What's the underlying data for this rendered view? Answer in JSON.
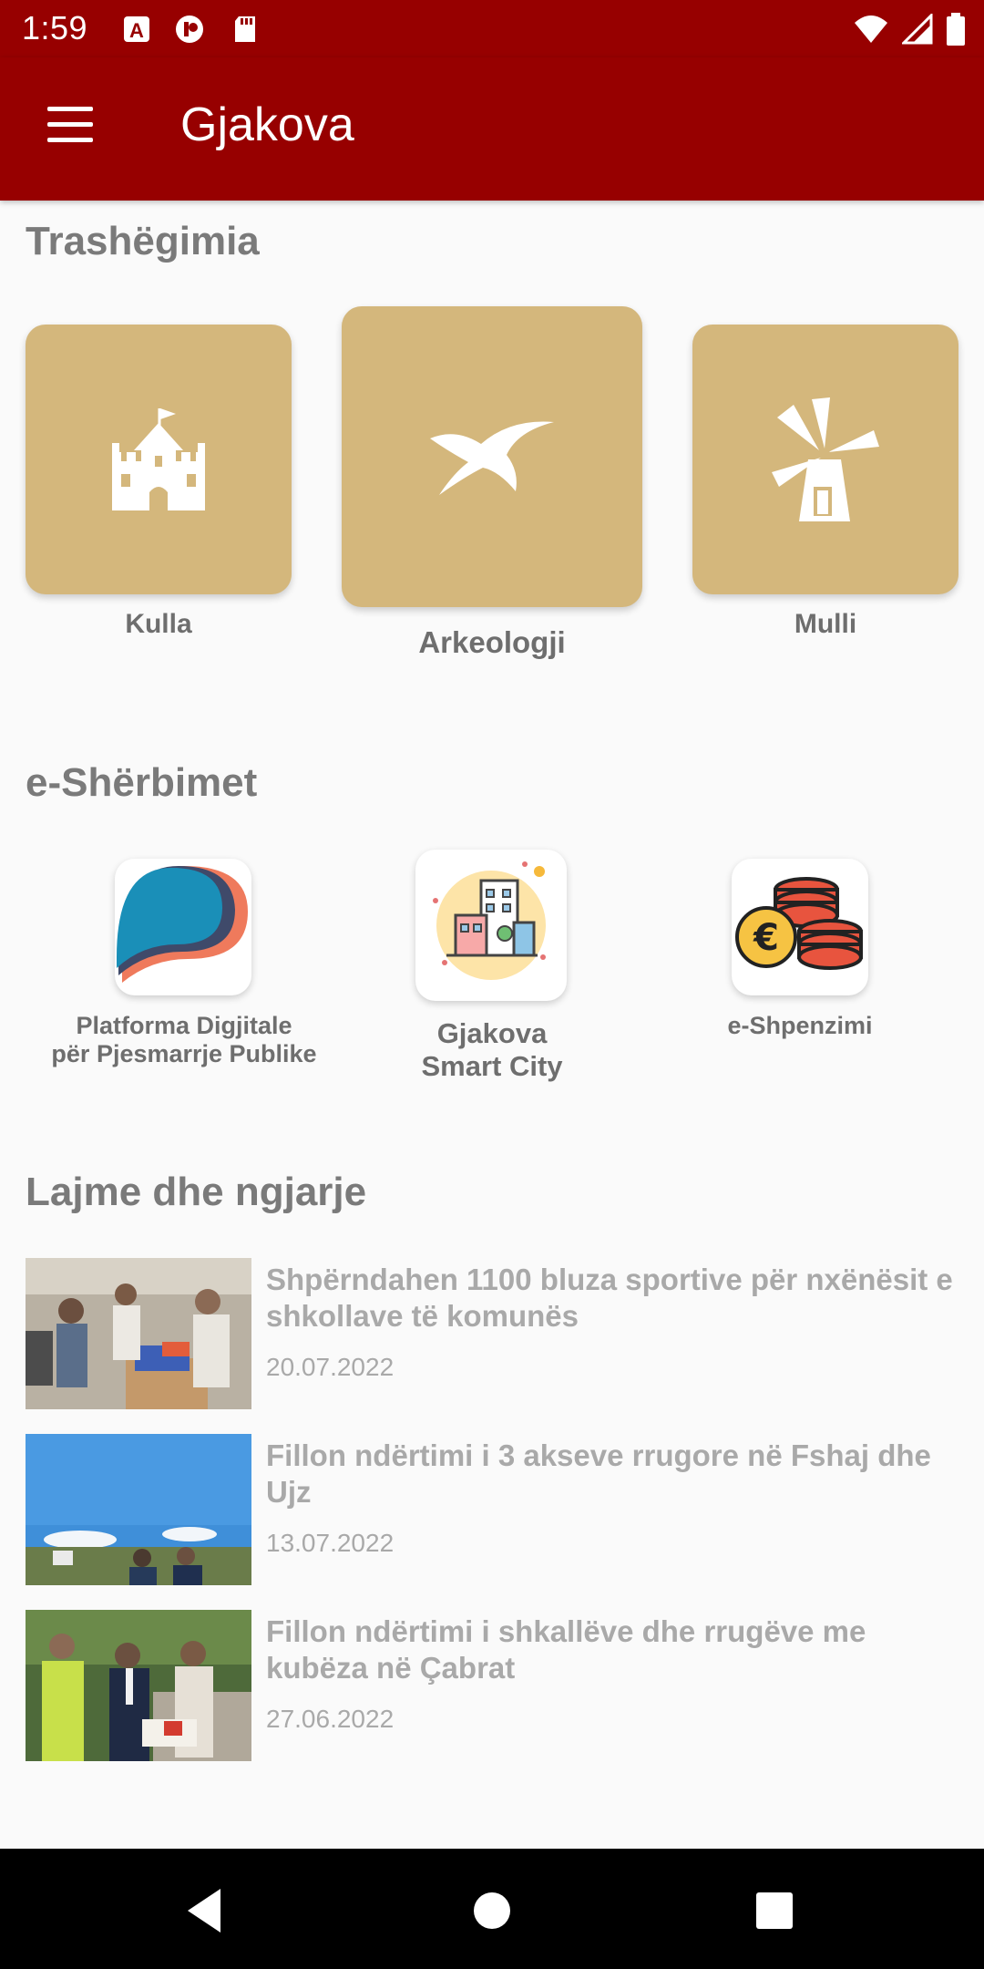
{
  "status_bar": {
    "time": "1:59",
    "icons": [
      "a-badge-icon",
      "circle-app-icon",
      "sd-card-icon",
      "wifi-icon",
      "signal-icon",
      "battery-icon"
    ]
  },
  "app_bar": {
    "title": "Gjakova",
    "menu_icon": "hamburger-menu-icon",
    "color": "#970000"
  },
  "heritage": {
    "title": "Trashëgimia",
    "card_color": "#d4b77c",
    "items": [
      {
        "label": "Kulla",
        "icon": "castle-icon"
      },
      {
        "label": "Arkeologji",
        "icon": "bird-icon"
      },
      {
        "label": "Mulli",
        "icon": "windmill-icon"
      }
    ]
  },
  "services": {
    "title": "e-Shërbimet",
    "items": [
      {
        "label_line1": "Platforma Digjitale",
        "label_line2": "për Pjesmarrje Publike",
        "icon": "platform-logo-icon"
      },
      {
        "label_line1": "Gjakova",
        "label_line2": "Smart City",
        "icon": "smart-city-icon"
      },
      {
        "label_line1": "e-Shpenzimi",
        "label_line2": "",
        "icon": "euro-coins-icon"
      }
    ]
  },
  "news": {
    "title": "Lajme dhe ngjarje",
    "items": [
      {
        "title": "Shpërndahen 1100 bluza sportive për nxënësit e shkollave të komunës",
        "date": "20.07.2022"
      },
      {
        "title": "Fillon ndërtimi i 3 akseve rrugore në Fshaj dhe Ujz",
        "date": "13.07.2022"
      },
      {
        "title": "Fillon ndërtimi i shkallëve dhe rrugëve me kubëza në Çabrat",
        "date": "27.06.2022"
      }
    ]
  },
  "nav_bar": {
    "back_icon": "back-triangle-icon",
    "home_icon": "home-circle-icon",
    "recents_icon": "recents-square-icon"
  }
}
